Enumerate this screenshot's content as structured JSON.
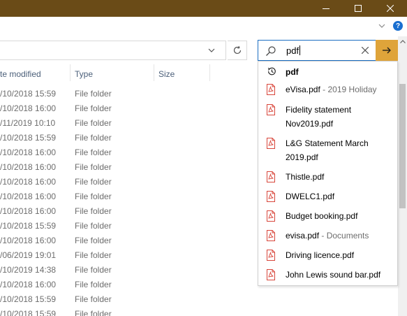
{
  "window": {
    "controls": [
      "minimize",
      "maximize",
      "close"
    ]
  },
  "ribbon": {
    "help_label": "?"
  },
  "search": {
    "query": "pdf"
  },
  "columns": {
    "date_modified": "te modified",
    "type": "Type",
    "size": "Size"
  },
  "rows": [
    {
      "date": "/10/2018 15:59",
      "type": "File folder"
    },
    {
      "date": "/10/2018 16:00",
      "type": "File folder"
    },
    {
      "date": "/11/2019 10:10",
      "type": "File folder"
    },
    {
      "date": "/10/2018 15:59",
      "type": "File folder"
    },
    {
      "date": "/10/2018 16:00",
      "type": "File folder"
    },
    {
      "date": "/10/2018 16:00",
      "type": "File folder"
    },
    {
      "date": "/10/2018 16:00",
      "type": "File folder"
    },
    {
      "date": "/10/2018 16:00",
      "type": "File folder"
    },
    {
      "date": "/10/2018 16:00",
      "type": "File folder"
    },
    {
      "date": "/10/2018 15:59",
      "type": "File folder"
    },
    {
      "date": "/10/2018 16:00",
      "type": "File folder"
    },
    {
      "date": "/06/2019 19:01",
      "type": "File folder"
    },
    {
      "date": "/10/2019 14:38",
      "type": "File folder"
    },
    {
      "date": "/10/2018 16:00",
      "type": "File folder"
    },
    {
      "date": "/10/2018 15:59",
      "type": "File folder"
    },
    {
      "date": "/10/2018 15:59",
      "type": "File folder"
    }
  ],
  "suggestions": {
    "history": "pdf",
    "items": [
      {
        "line1_bold": "eVisa.pdf",
        "loc": " - 2019 Holiday",
        "line2_bold": ""
      },
      {
        "line1_bold": "Fidelity statement",
        "loc": "",
        "line2_bold": "Nov2019.pdf"
      },
      {
        "line1_bold": "L&G Statement March",
        "loc": "",
        "line2_bold": "2019.pdf"
      },
      {
        "line1_bold": "Thistle.pdf",
        "loc": "",
        "line2_bold": ""
      },
      {
        "line1_bold": "DWELC1.pdf",
        "loc": "",
        "line2_bold": ""
      },
      {
        "line1_bold": "Budget booking.pdf",
        "loc": "",
        "line2_bold": ""
      },
      {
        "line1_bold": "evisa.pdf",
        "loc": " - Documents",
        "line2_bold": ""
      },
      {
        "line1_bold": "Driving licence.pdf",
        "loc": "",
        "line2_bold": ""
      },
      {
        "line1_bold": "John Lewis sound bar.pdf",
        "loc": "",
        "line2_bold": ""
      }
    ]
  },
  "colors": {
    "titlebar": "#6a4b17",
    "go_button": "#dfa43a",
    "pdf_icon": "#d8453a",
    "search_border": "#1b6ec2"
  },
  "icons": {
    "search": "search-icon",
    "clear": "close-icon",
    "go": "arrow-right-icon",
    "refresh": "refresh-icon",
    "history": "history-icon",
    "file": "pdf-file-icon"
  }
}
